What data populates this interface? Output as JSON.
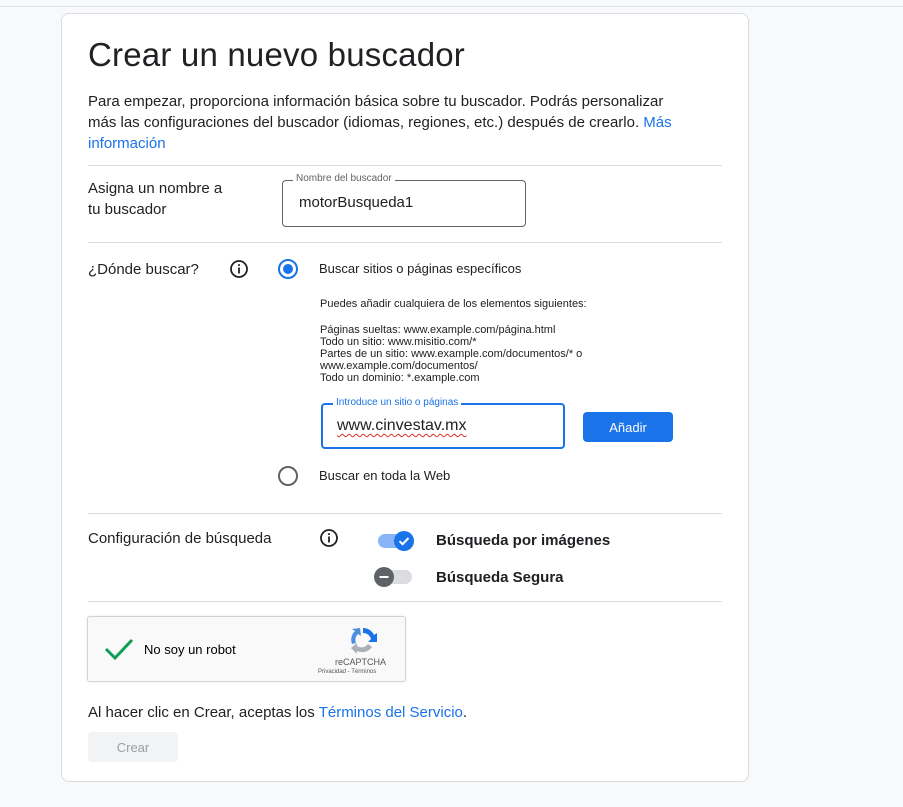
{
  "page": {
    "title": "Crear un nuevo buscador",
    "intro_text": "Para empezar, proporciona información básica sobre tu buscador. Podrás personalizar más las configuraciones del buscador (idiomas, regiones, etc.) después de crearlo.",
    "intro_link": "Más información"
  },
  "name_section": {
    "label_line1": "Asigna un nombre a",
    "label_line2": "tu buscador",
    "field_label": "Nombre del buscador",
    "field_value": "motorBusqueda1"
  },
  "where_section": {
    "label": "¿Dónde buscar?",
    "option_specific": "Buscar sitios o páginas específicos",
    "option_specific_selected": true,
    "help_intro": "Puedes añadir cualquiera de los elementos siguientes:",
    "help_lines": [
      "Páginas sueltas: www.example.com/página.html",
      "Todo un sitio: www.misitio.com/*",
      "Partes de un sitio: www.example.com/documentos/* o",
      "www.example.com/documentos/",
      "Todo un dominio: *.example.com"
    ],
    "site_field_label": "Introduce un sitio o páginas",
    "site_field_value": "www.cinvestav.mx",
    "add_button": "Añadir",
    "option_web": "Buscar en toda la Web",
    "option_web_selected": false
  },
  "config_section": {
    "label": "Configuración de búsqueda",
    "image_search_label": "Búsqueda por imágenes",
    "image_search_enabled": true,
    "safe_search_label": "Búsqueda Segura",
    "safe_search_enabled": false
  },
  "captcha": {
    "label": "No soy un robot",
    "checked": true,
    "brand": "reCAPTCHA",
    "footer": "Privacidad - Términos"
  },
  "footer": {
    "terms_prefix": "Al hacer clic en Crear, aceptas los",
    "terms_link": "Términos del Servicio",
    "terms_suffix": ".",
    "create_button": "Crear"
  },
  "colors": {
    "accent": "#1a73e8",
    "check_green": "#0f9d58"
  },
  "icons": [
    "info-icon",
    "checkmark-icon",
    "recaptcha-logo-icon"
  ]
}
